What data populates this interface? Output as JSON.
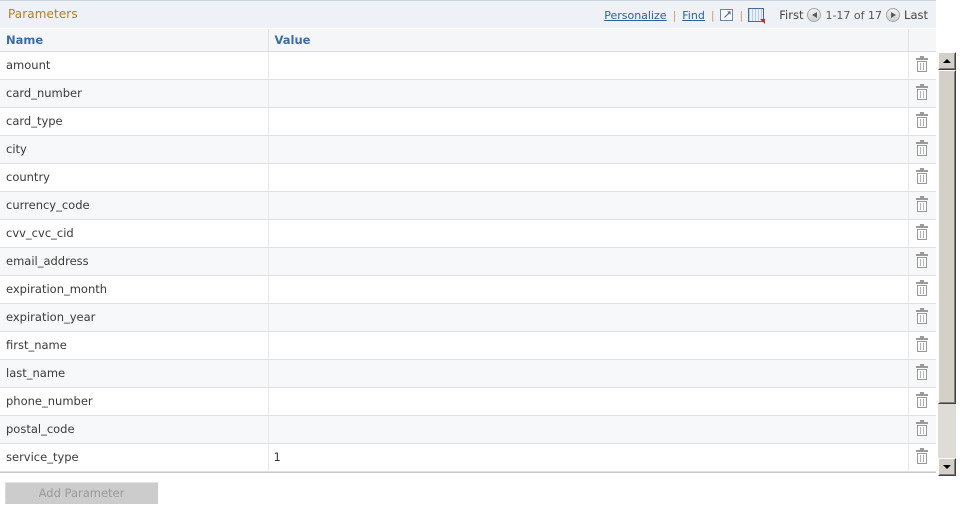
{
  "grid": {
    "title": "Parameters",
    "toolbar": {
      "personalize_label": "Personalize",
      "find_label": "Find",
      "separator": "|",
      "expand_icon": "expand-icon",
      "download_grid_icon": "download-to-spreadsheet-icon"
    },
    "pager": {
      "first_label": "First",
      "prev_icon": "previous-arrow-icon",
      "range_label": "1-17 of 17",
      "next_icon": "next-arrow-icon",
      "last_label": "Last"
    },
    "columns": [
      {
        "key": "name",
        "label": "Name"
      },
      {
        "key": "value",
        "label": "Value"
      },
      {
        "key": "delete",
        "label": ""
      }
    ],
    "rows": [
      {
        "name": "amount",
        "value": ""
      },
      {
        "name": "card_number",
        "value": ""
      },
      {
        "name": "card_type",
        "value": ""
      },
      {
        "name": "city",
        "value": ""
      },
      {
        "name": "country",
        "value": ""
      },
      {
        "name": "currency_code",
        "value": ""
      },
      {
        "name": "cvv_cvc_cid",
        "value": ""
      },
      {
        "name": "email_address",
        "value": ""
      },
      {
        "name": "expiration_month",
        "value": ""
      },
      {
        "name": "expiration_year",
        "value": ""
      },
      {
        "name": "first_name",
        "value": ""
      },
      {
        "name": "last_name",
        "value": ""
      },
      {
        "name": "phone_number",
        "value": ""
      },
      {
        "name": "postal_code",
        "value": ""
      },
      {
        "name": "service_type",
        "value": "1"
      }
    ],
    "row_delete_icon": "trash-icon"
  },
  "actions": {
    "add_parameter_label": "Add Parameter",
    "add_parameter_disabled": true
  },
  "scrollbar": {
    "up_icon": "scroll-up-arrow-icon",
    "down_icon": "scroll-down-arrow-icon",
    "thumb": "scrollbar-thumb"
  },
  "colors": {
    "title_text": "#c07a1e",
    "column_header_text": "#3d6ca3",
    "link": "#2f5f9e",
    "titlebar_bg": "#eef2f7",
    "row_alt_bg": "#f7f8f9",
    "disabled_button_bg": "#cccccc",
    "disabled_button_text": "#9a9a9a"
  }
}
